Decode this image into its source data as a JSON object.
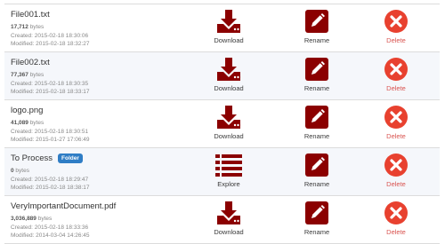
{
  "colors": {
    "action": "#8b0000",
    "delete": "#e8412f",
    "folder_badge": "#2f7dc5"
  },
  "icons": {
    "download": "download-icon",
    "explore": "list-icon",
    "rename": "pencil-icon",
    "delete": "close-circle-icon"
  },
  "files": [
    {
      "name": "File001.txt",
      "badge": "",
      "size": "17,712",
      "size_unit": " bytes",
      "created": "Created: 2015-02-18 18:30:06",
      "modified": "Modified: 2015-02-18 18:32:27",
      "primary": "Download",
      "rename": "Rename",
      "delete": "Delete"
    },
    {
      "name": "File002.txt",
      "badge": "",
      "size": "77,367",
      "size_unit": " bytes",
      "created": "Created: 2015-02-18 18:30:35",
      "modified": "Modified: 2015-02-18 18:33:17",
      "primary": "Download",
      "rename": "Rename",
      "delete": "Delete"
    },
    {
      "name": "logo.png",
      "badge": "",
      "size": "41,089",
      "size_unit": " bytes",
      "created": "Created: 2015-02-18 18:30:51",
      "modified": "Modified: 2015-01-27 17:06:49",
      "primary": "Download",
      "rename": "Rename",
      "delete": "Delete"
    },
    {
      "name": "To Process",
      "badge": "Folder",
      "size": "0",
      "size_unit": " bytes",
      "created": "Created: 2015-02-18 18:29:47",
      "modified": "Modified: 2015-02-18 18:38:17",
      "primary": "Explore",
      "rename": "Rename",
      "delete": "Delete"
    },
    {
      "name": "VeryImportantDocument.pdf",
      "badge": "",
      "size": "3,036,889",
      "size_unit": " bytes",
      "created": "Created: 2015-02-18 18:33:36",
      "modified": "Modified: 2014-03-04 14:26:45",
      "primary": "Download",
      "rename": "Rename",
      "delete": "Delete"
    }
  ]
}
